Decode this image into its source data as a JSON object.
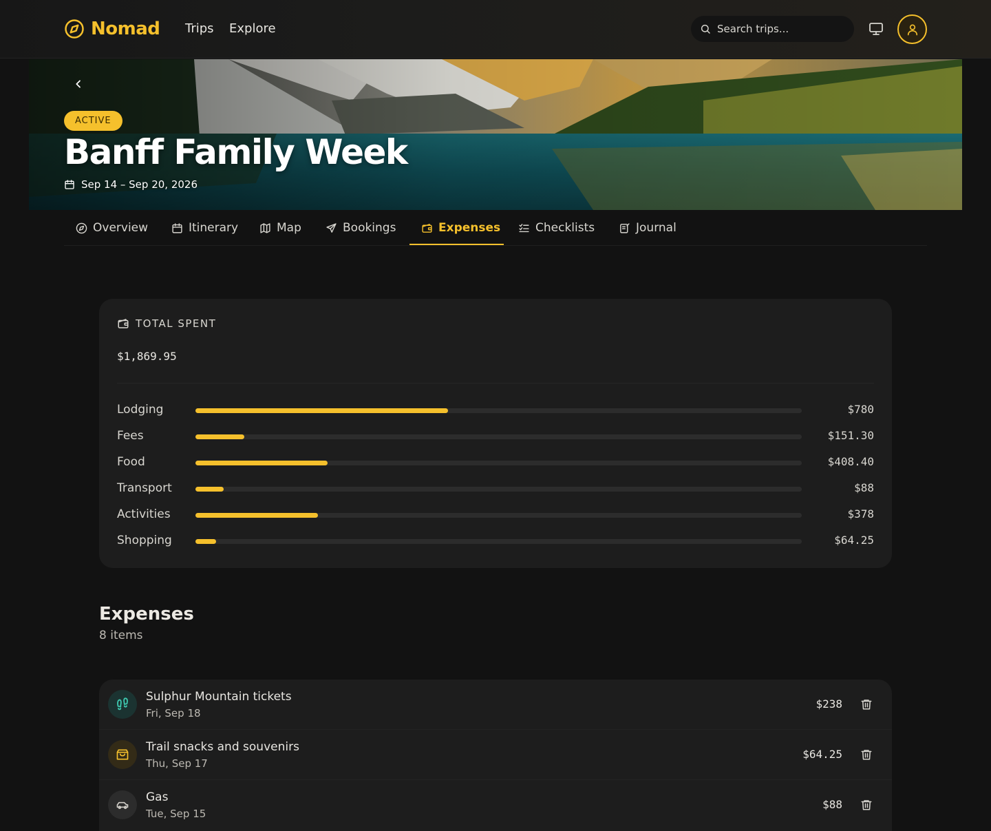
{
  "brand": {
    "name": "Nomad",
    "icon": "compass-icon",
    "color": "#f5c02c"
  },
  "nav": {
    "links": [
      "Trips",
      "Explore"
    ]
  },
  "search": {
    "placeholder": "Search trips..."
  },
  "trip": {
    "status": "ACTIVE",
    "title": "Banff Family Week",
    "dates": "Sep 14 – Sep 20, 2026"
  },
  "tabs": [
    {
      "label": "Overview",
      "icon": "compass-icon",
      "active": false
    },
    {
      "label": "Itinerary",
      "icon": "calendar-icon",
      "active": false
    },
    {
      "label": "Map",
      "icon": "map-icon",
      "active": false
    },
    {
      "label": "Bookings",
      "icon": "plane-icon",
      "active": false
    },
    {
      "label": "Expenses",
      "icon": "wallet-icon",
      "active": true
    },
    {
      "label": "Checklists",
      "icon": "checklist-icon",
      "active": false
    },
    {
      "label": "Journal",
      "icon": "journal-icon",
      "active": false
    }
  ],
  "summary": {
    "label": "TOTAL SPENT",
    "total": "$1,869.95",
    "categories": [
      {
        "name": "Lodging",
        "amount": "$780",
        "value": 780
      },
      {
        "name": "Fees",
        "amount": "$151.30",
        "value": 151.3
      },
      {
        "name": "Food",
        "amount": "$408.40",
        "value": 408.4
      },
      {
        "name": "Transport",
        "amount": "$88",
        "value": 88
      },
      {
        "name": "Activities",
        "amount": "$378",
        "value": 378
      },
      {
        "name": "Shopping",
        "amount": "$64.25",
        "value": 64.25
      }
    ]
  },
  "expenses": {
    "title": "Expenses",
    "count": "8 items",
    "items": [
      {
        "name": "Sulphur Mountain tickets",
        "date": "Fri, Sep 18",
        "amount": "$238",
        "icon": "footprints-icon",
        "icon_color": "#3ec9b0",
        "icon_bg": "#1b3331"
      },
      {
        "name": "Trail snacks and souvenirs",
        "date": "Thu, Sep 17",
        "amount": "$64.25",
        "icon": "shopping-bag-icon",
        "icon_color": "#f5c02c",
        "icon_bg": "#332b17"
      },
      {
        "name": "Gas",
        "date": "Tue, Sep 15",
        "amount": "$88",
        "icon": "car-icon",
        "icon_color": "#cfccc6",
        "icon_bg": "#2c2c2c"
      }
    ]
  }
}
